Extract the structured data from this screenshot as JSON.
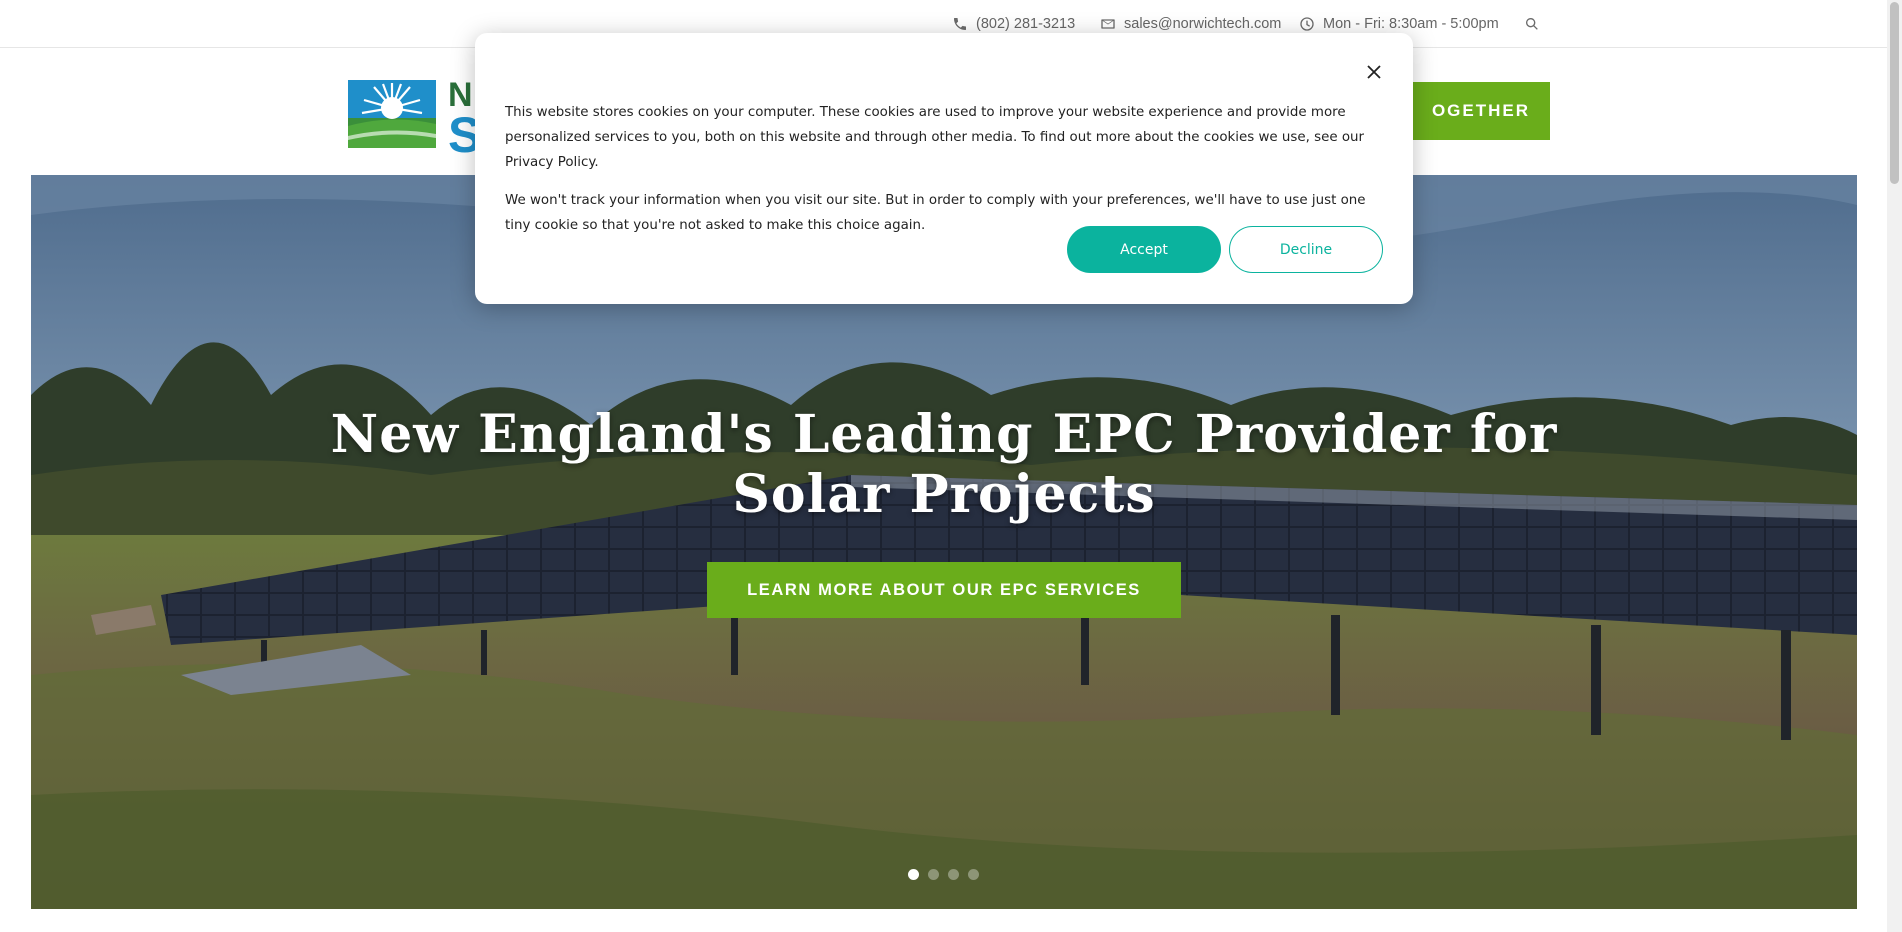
{
  "topbar": {
    "phone": "(802) 281-3213",
    "email": "sales@norwichtech.com",
    "hours": "Mon - Fri: 8:30am - 5:00pm",
    "icons": [
      "phone-icon",
      "mail-icon",
      "clock-icon",
      "search-icon"
    ]
  },
  "header": {
    "logo_letters": [
      "N",
      "S"
    ],
    "cta_label": "OGETHER"
  },
  "hero": {
    "title": "New England's Leading EPC Provider for Solar Projects",
    "button_label": "LEARN MORE ABOUT OUR EPC SERVICES",
    "slides_total": 4,
    "active_slide": 1
  },
  "cookie_modal": {
    "paragraph_1": "This website stores cookies on your computer. These cookies are used to improve your website experience and provide more personalized services to you, both on this website and through other media. To find out more about the cookies we use, see our Privacy Policy.",
    "paragraph_2": "We won't track your information when you visit our site. But in order to comply with your preferences, we'll have to use just one tiny cookie so that you're not asked to make this choice again.",
    "accept_label": "Accept",
    "decline_label": "Decline"
  },
  "colors": {
    "brand_green": "#6aad1b",
    "accept_teal": "#0bb39e",
    "logo_blue": "#1f8fca"
  }
}
